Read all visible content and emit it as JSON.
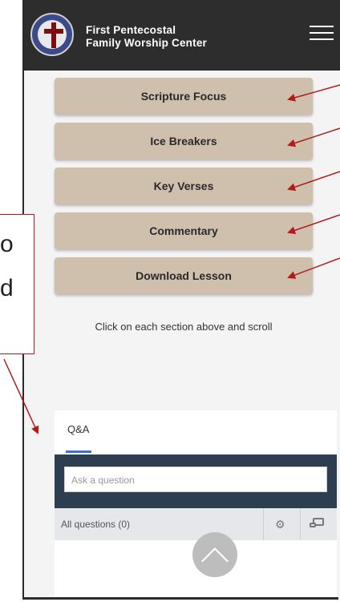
{
  "header": {
    "brand_line1": "First Pentecostal",
    "brand_line2": "Family Worship Center",
    "menu_icon": "hamburger-menu-icon"
  },
  "sections": [
    {
      "label": "Scripture Focus"
    },
    {
      "label": "Ice Breakers"
    },
    {
      "label": "Key Verses"
    },
    {
      "label": "Commentary"
    },
    {
      "label": "Download Lesson"
    }
  ],
  "hint_text": "Click on each section above and scroll",
  "qa": {
    "tab_label": "Q&A",
    "input_placeholder": "Ask a question",
    "filter_label": "All questions (0)",
    "settings_icon": "gear-icon",
    "popout_icon": "popout-icon",
    "scroll_icon": "chevron-up-icon"
  },
  "callout": {
    "line1": "o",
    "line2": "d"
  },
  "colors": {
    "header_bg": "#2d2d2d",
    "section_button": "#cfbfad",
    "annotation_red": "#b31b1b",
    "qa_bar": "#2c3e50",
    "qa_tab_accent": "#3b6fd8"
  }
}
